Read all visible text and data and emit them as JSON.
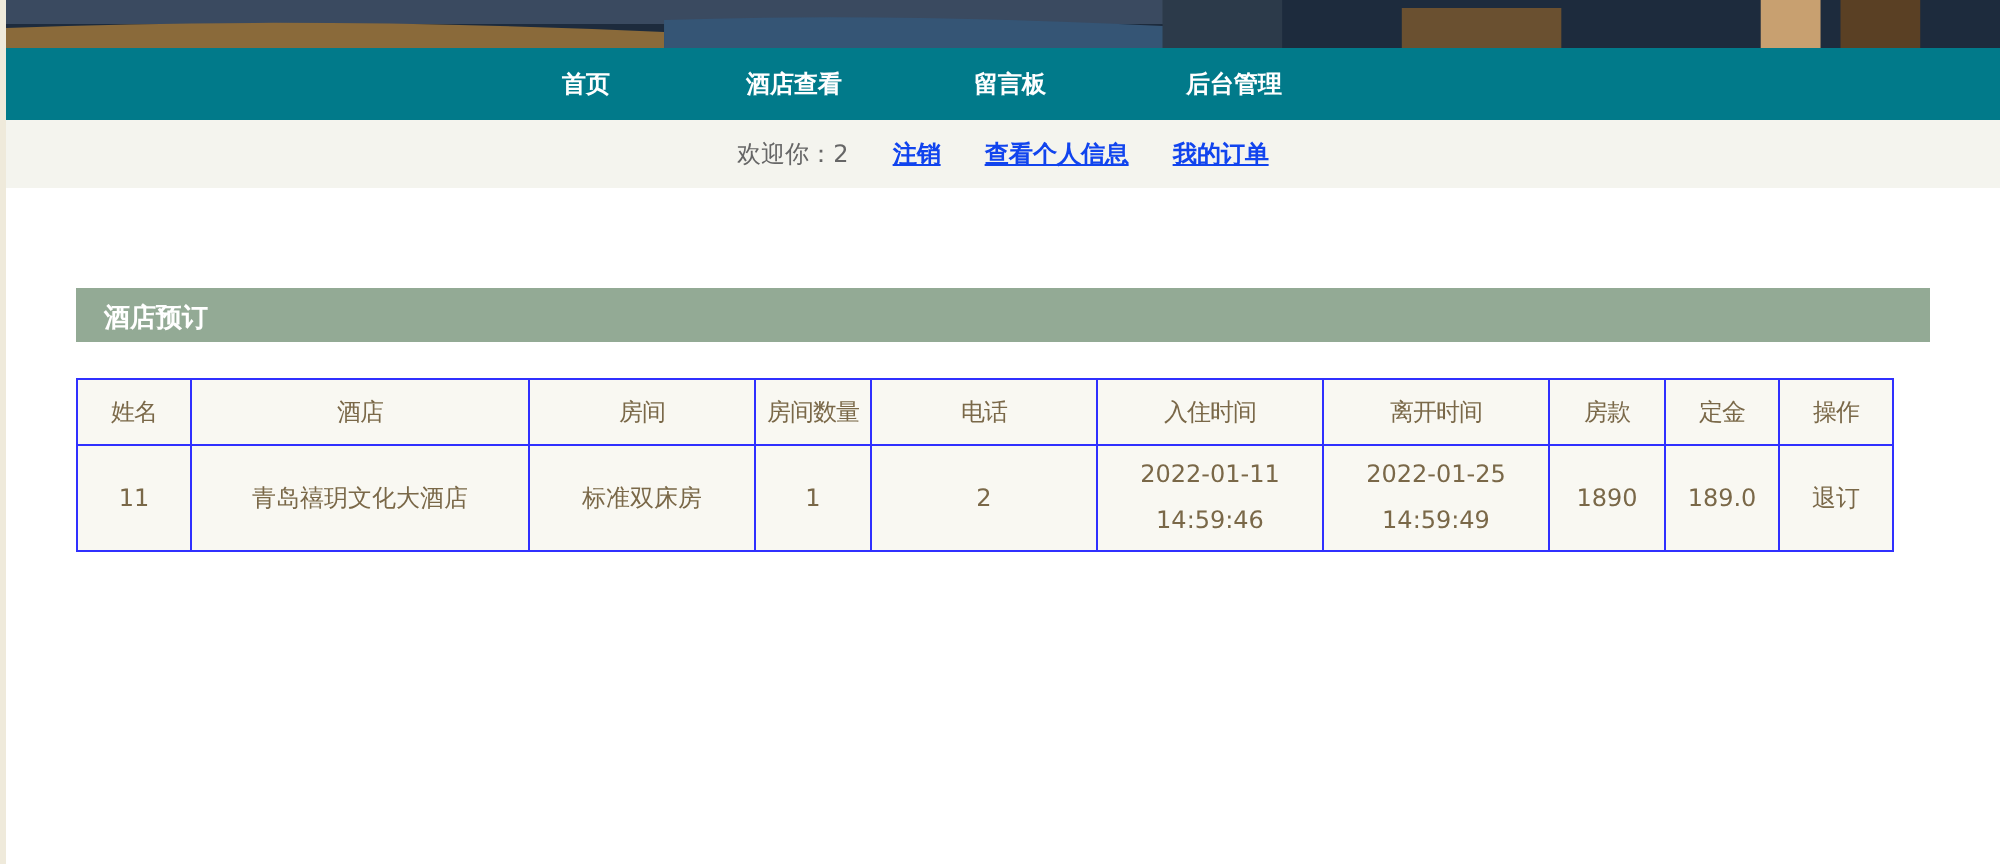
{
  "nav": [
    {
      "label": "首页"
    },
    {
      "label": "酒店查看"
    },
    {
      "label": "留言板"
    },
    {
      "label": "后台管理"
    }
  ],
  "welcome": {
    "text": "欢迎你：2",
    "links": [
      "注销",
      "查看个人信息",
      "我的订单"
    ]
  },
  "section": {
    "title": "酒店预订"
  },
  "table": {
    "columns": [
      "姓名",
      "酒店",
      "房间",
      "房间数量",
      "电话",
      "入住时间",
      "离开时间",
      "房款",
      "定金",
      "操作"
    ],
    "rows": [
      {
        "cells": [
          "11",
          "青岛禧玥文化大酒店",
          "标准双床房",
          "1",
          "2",
          "2022-01-11 14:59:46",
          "2022-01-25 14:59:49",
          "1890",
          "189.0",
          "退订"
        ]
      }
    ]
  }
}
